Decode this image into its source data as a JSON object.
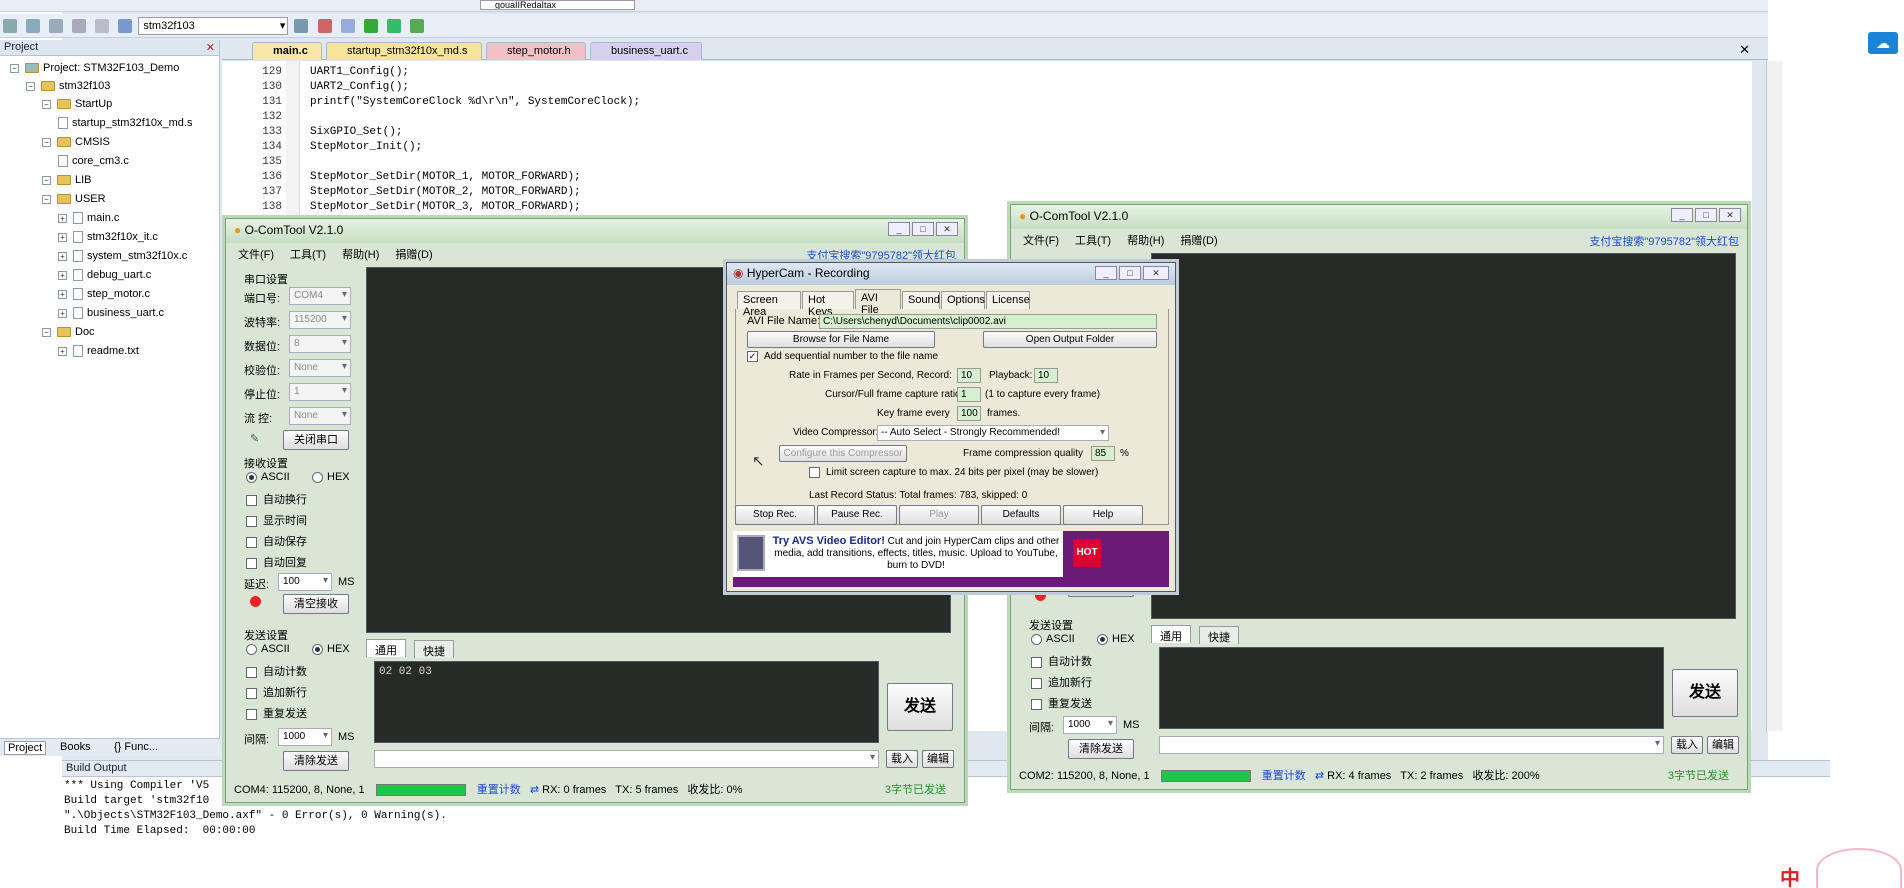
{
  "ide": {
    "toolbar2_target": "stm32f103",
    "toolbar_combo": "gouaIIRedaItax",
    "project_panel": {
      "title": "Project",
      "root": "Project: STM32F103_Demo",
      "target": "stm32f103",
      "items": [
        {
          "label": "StartUp",
          "kind": "folder"
        },
        {
          "label": "startup_stm32f10x_md.s",
          "kind": "file"
        },
        {
          "label": "CMSIS",
          "kind": "folder"
        },
        {
          "label": "core_cm3.c",
          "kind": "file"
        },
        {
          "label": "LIB",
          "kind": "folder"
        },
        {
          "label": "USER",
          "kind": "folder"
        },
        {
          "label": "main.c",
          "kind": "file"
        },
        {
          "label": "stm32f10x_it.c",
          "kind": "file"
        },
        {
          "label": "system_stm32f10x.c",
          "kind": "file"
        },
        {
          "label": "debug_uart.c",
          "kind": "file"
        },
        {
          "label": "step_motor.c",
          "kind": "file"
        },
        {
          "label": "business_uart.c",
          "kind": "file"
        },
        {
          "label": "Doc",
          "kind": "folder"
        },
        {
          "label": "readme.txt",
          "kind": "file"
        }
      ],
      "bottom_tabs": [
        "Project",
        "Books",
        "{} Func..."
      ]
    },
    "tabs": [
      "main.c",
      "startup_stm32f10x_md.s",
      "step_motor.h",
      "business_uart.c"
    ],
    "tab_colors": [
      "#f8e8a8",
      "#f6e49a",
      "#f4c0c8",
      "#d8d0f0"
    ],
    "code": [
      {
        "n": "129",
        "t": "UART1_Config();"
      },
      {
        "n": "130",
        "t": "UART2_Config();"
      },
      {
        "n": "131",
        "t": "printf(\"SystemCoreClock %d\\r\\n\", SystemCoreClock);"
      },
      {
        "n": "132",
        "t": ""
      },
      {
        "n": "133",
        "t": "SixGPIO_Set();"
      },
      {
        "n": "134",
        "t": "StepMotor_Init();"
      },
      {
        "n": "135",
        "t": ""
      },
      {
        "n": "136",
        "t": "StepMotor_SetDir(MOTOR_1, MOTOR_FORWARD);"
      },
      {
        "n": "137",
        "t": "StepMotor_SetDir(MOTOR_2, MOTOR_FORWARD);"
      },
      {
        "n": "138",
        "t": "StepMotor_SetDir(MOTOR_3, MOTOR_FORWARD);"
      }
    ],
    "build": {
      "title": "Build Output",
      "lines": [
        "*** Using Compiler 'V5",
        "Build target 'stm32f10",
        "\".\\Objects\\STM32F103_Demo.axf\" - 0 Error(s), 0 Warning(s).",
        "Build Time Elapsed:  00:00:00"
      ]
    }
  },
  "comtool1": {
    "title": "O-ComTool V2.1.0",
    "menu": [
      "文件(F)",
      "工具(T)",
      "帮助(H)",
      "捐赠(D)"
    ],
    "ad": "支付宝搜索\"9795782\"领大红包",
    "serial_group": "串口设置",
    "fields": [
      {
        "label": "端口号:",
        "value": "COM4"
      },
      {
        "label": "波特率:",
        "value": "115200"
      },
      {
        "label": "数据位:",
        "value": "8"
      },
      {
        "label": "校验位:",
        "value": "None"
      },
      {
        "label": "停止位:",
        "value": "1"
      },
      {
        "label": "流  控:",
        "value": "None"
      }
    ],
    "close_port": "关闭串口",
    "recv_group": "接收设置",
    "ascii": "ASCII",
    "hex": "HEX",
    "recv_opts": [
      "自动换行",
      "显示时间",
      "自动保存",
      "自动回复"
    ],
    "delay_label": "延迟:",
    "delay": "100",
    "ms": "MS",
    "clear_recv": "清空接收",
    "send_group": "发送设置",
    "send_opts": [
      "自动计数",
      "追加新行",
      "重复发送"
    ],
    "interval_label": "间隔:",
    "interval": "1000",
    "clear_send": "清除发送",
    "tabs": [
      "通用",
      "快捷"
    ],
    "send_text": "02 02 03",
    "send_btn": "发送",
    "load": "载入",
    "edit": "编辑",
    "status": {
      "port": "COM4: 115200, 8, None, 1",
      "reset": "重置计数",
      "rx": "RX: 0 frames",
      "tx": "TX: 5 frames",
      "ratio": "收发比:  0%",
      "sent": "3字节已发送"
    }
  },
  "comtool2": {
    "title": "O-ComTool V2.1.0",
    "menu": [
      "文件(F)",
      "工具(T)",
      "帮助(H)",
      "捐赠(D)"
    ],
    "ad": "支付宝搜索\"9795782\"领大红包",
    "serial_partial": "串口设置",
    "send_group": "发送设置",
    "ascii": "ASCII",
    "hex": "HEX",
    "send_opts": [
      "自动计数",
      "追加新行",
      "重复发送"
    ],
    "interval_label": "间隔:",
    "interval": "1000",
    "ms": "MS",
    "clear_send": "清除发送",
    "tabs": [
      "通用",
      "快捷"
    ],
    "send_btn": "发送",
    "load": "载入",
    "edit": "编辑",
    "status": {
      "port": "COM2: 115200, 8, None, 1",
      "reset": "重置计数",
      "rx": "RX: 4 frames",
      "tx": "TX: 2 frames",
      "ratio": "收发比:  200%",
      "sent": "3字节已发送"
    }
  },
  "hypercam": {
    "title": "HyperCam - Recording",
    "tabs": [
      "Screen Area",
      "Hot Keys",
      "AVI File",
      "Sound",
      "Options",
      "License"
    ],
    "avi_label": "AVI File Name:",
    "avi_path": "C:\\Users\\chenyd\\Documents\\clip0002.avi",
    "browse": "Browse for File Name",
    "open_folder": "Open Output Folder",
    "seq_label": "Add sequential number to the file name",
    "rate_label": "Rate in Frames per Second,  Record:",
    "record": "10",
    "playback_label": "Playback:",
    "playback": "10",
    "ratio_label": "Cursor/Full frame capture ratio",
    "ratio": "1",
    "ratio_note": "(1 to capture every frame)",
    "key_label": "Key frame every",
    "key": "100",
    "frames": "frames.",
    "comp_label": "Video Compressor:",
    "comp": "-- Auto Select - Strongly Recommended!",
    "configure": "Configure this Compressor",
    "quality_label": "Frame compression quality",
    "quality": "85",
    "pct": "%",
    "limit_label": "Limit screen capture to max. 24 bits per pixel (may be slower)",
    "last_status": "Last Record Status: Total frames: 783, skipped: 0",
    "buttons": [
      "Stop Rec.",
      "Pause Rec.",
      "Play",
      "Defaults",
      "Help"
    ],
    "ad_bold": "Try AVS Video Editor!",
    "ad_text": " Cut and join HyperCam clips and other media, add transitions, effects, titles, music. Upload to YouTube, burn to DVD!",
    "hot": "HOT"
  },
  "ime": {
    "char": "中"
  }
}
